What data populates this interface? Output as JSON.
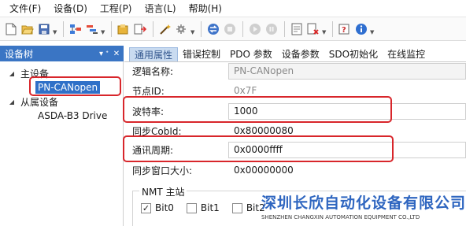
{
  "menu": [
    {
      "label": "文件(F)"
    },
    {
      "label": "设备(D)"
    },
    {
      "label": "工程(P)"
    },
    {
      "label": "语言(L)"
    },
    {
      "label": "帮助(H)"
    }
  ],
  "toolbar": {
    "buttons": [
      "new-file-icon",
      "open-folder-icon",
      "save-icon",
      "network-scan-icon",
      "device-config-icon",
      "upload-icon",
      "download-icon",
      "wand-icon",
      "gear-icon",
      "connect-icon",
      "stop-icon",
      "play-icon",
      "pause-icon",
      "monitor-icon",
      "delete-doc-icon",
      "help-icon",
      "info-icon"
    ]
  },
  "left_panel": {
    "title": "设备树",
    "pin_glyph": "▾ ᐩ",
    "close_glyph": "✕",
    "tree": {
      "master_label": "主设备",
      "master_child": "PN-CANopen",
      "slave_label": "从属设备",
      "slave_child": "ASDA-B3 Drive",
      "toggle_glyph": "◢"
    }
  },
  "tabs": [
    {
      "label": "通用属性",
      "active": true
    },
    {
      "label": "错误控制",
      "active": false
    },
    {
      "label": "PDO 参数",
      "active": false
    },
    {
      "label": "设备参数",
      "active": false
    },
    {
      "label": "SDO初始化",
      "active": false
    },
    {
      "label": "在线监控",
      "active": false
    }
  ],
  "properties": {
    "logic_name": {
      "label": "逻辑名称:",
      "value": "PN-CANopen"
    },
    "node_id": {
      "label": "节点ID:",
      "value": "0x7F"
    },
    "baud_rate": {
      "label": "波特率:",
      "value": "1000"
    },
    "sync_cobid": {
      "label": "同步CobId:",
      "value": "0x80000080"
    },
    "comm_cycle": {
      "label": "通讯周期:",
      "value": "0x0000ffff"
    },
    "sync_window": {
      "label": "同步窗口大小:",
      "value": "0x00000000"
    }
  },
  "nmt": {
    "title": "NMT 主站",
    "bits": [
      {
        "label": "Bit0",
        "checked": true
      },
      {
        "label": "Bit1",
        "checked": false
      },
      {
        "label": "Bit2",
        "checked": false
      }
    ],
    "check_glyph": "✓"
  },
  "watermark": {
    "company_cn": "深圳长欣自动化设备有限公司",
    "company_en": "SHENZHEN CHANGXIN AUTOMATION EQUIPMENT CO.,LTD"
  },
  "colors": {
    "panel_header": "#3a75c4",
    "tree_selected": "#2f70c8",
    "active_tab": "#c9dbf0",
    "highlight": "#d8262b",
    "watermark_blue": "#2f66c0"
  }
}
